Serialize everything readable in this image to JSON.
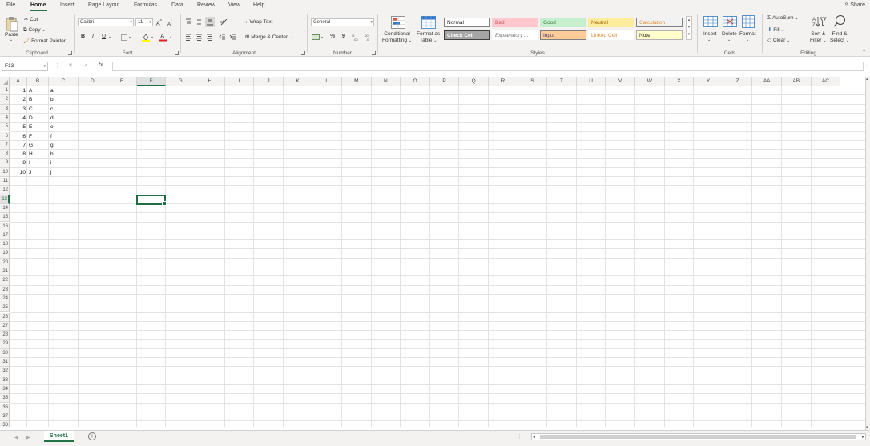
{
  "menu": {
    "tabs": [
      "File",
      "Home",
      "Insert",
      "Page Layout",
      "Formulas",
      "Data",
      "Review",
      "View",
      "Help"
    ],
    "active": "Home",
    "share_label": "Share"
  },
  "ribbon": {
    "clipboard": {
      "label": "Clipboard",
      "paste": "Paste",
      "cut": "Cut",
      "copy": "Copy",
      "format_painter": "Format Painter"
    },
    "font": {
      "label": "Font",
      "font_name": "Calibri",
      "font_size": "11",
      "bold": "B",
      "italic": "I",
      "underline": "U"
    },
    "alignment": {
      "label": "Alignment",
      "wrap_text": "Wrap Text",
      "merge_center": "Merge & Center"
    },
    "number": {
      "label": "Number",
      "format": "General",
      "percent": "%",
      "comma": "9"
    },
    "styles": {
      "label": "Styles",
      "conditional_formatting": [
        "Conditional",
        "Formatting"
      ],
      "format_as_table": [
        "Format as",
        "Table"
      ],
      "cells": [
        {
          "name": "Normal",
          "bg": "#ffffff",
          "fg": "#222222",
          "border": "#7f7f7f"
        },
        {
          "name": "Bad",
          "bg": "#ffc7ce",
          "fg": "#c4575f",
          "border": "#ffc7ce"
        },
        {
          "name": "Good",
          "bg": "#c6efce",
          "fg": "#3f7d4a",
          "border": "#c6efce"
        },
        {
          "name": "Neutral",
          "bg": "#ffeb9c",
          "fg": "#9c6500",
          "border": "#ffeb9c"
        },
        {
          "name": "Calculation",
          "bg": "#f2f2f2",
          "fg": "#e08a35",
          "border": "#7f7f7f"
        },
        {
          "name": "Check Cell",
          "bg": "#a5a5a5",
          "fg": "#ffffff",
          "border": "#3f3f3f"
        },
        {
          "name": "Explanatory ...",
          "bg": "#ffffff",
          "fg": "#7f7f7f",
          "border": "#ffffff"
        },
        {
          "name": "Input",
          "bg": "#ffcc99",
          "fg": "#3f3f76",
          "border": "#7f7f7f"
        },
        {
          "name": "Linked Cell",
          "bg": "#ffffff",
          "fg": "#e08a35",
          "border": "#ffffff"
        },
        {
          "name": "Note",
          "bg": "#ffffcc",
          "fg": "#222222",
          "border": "#b2b2b2"
        }
      ]
    },
    "cells": {
      "label": "Cells",
      "insert": "Insert",
      "delete": "Delete",
      "format": "Format"
    },
    "editing": {
      "label": "Editing",
      "autosum": "AutoSum",
      "fill": "Fill",
      "clear": "Clear",
      "sort_filter": [
        "Sort &",
        "Filter"
      ],
      "find_select": [
        "Find &",
        "Select"
      ]
    }
  },
  "formula_bar": {
    "name_box": "F13",
    "fx": "fx",
    "cancel": "✕",
    "enter": "✓",
    "formula": ""
  },
  "sheet": {
    "columns": [
      "A",
      "B",
      "C",
      "D",
      "E",
      "F",
      "G",
      "H",
      "I",
      "J",
      "K",
      "L",
      "M",
      "N",
      "O",
      "P",
      "Q",
      "R",
      "S",
      "T",
      "U",
      "V",
      "W",
      "X",
      "Y",
      "Z",
      "AA",
      "AB",
      "AC"
    ],
    "row_count": 38,
    "selected_column": "F",
    "selected_row": 13,
    "data": [
      [
        "1",
        "A",
        "a"
      ],
      [
        "2",
        "B",
        "b"
      ],
      [
        "3",
        "C",
        "c"
      ],
      [
        "4",
        "D",
        "d"
      ],
      [
        "5",
        "E",
        "e"
      ],
      [
        "6",
        "F",
        "f"
      ],
      [
        "7",
        "G",
        "g"
      ],
      [
        "8",
        "H",
        "h"
      ],
      [
        "9",
        "I",
        "i"
      ],
      [
        "10",
        "J",
        "j"
      ]
    ]
  },
  "tabs": {
    "sheet_name": "Sheet1",
    "add": "+"
  }
}
